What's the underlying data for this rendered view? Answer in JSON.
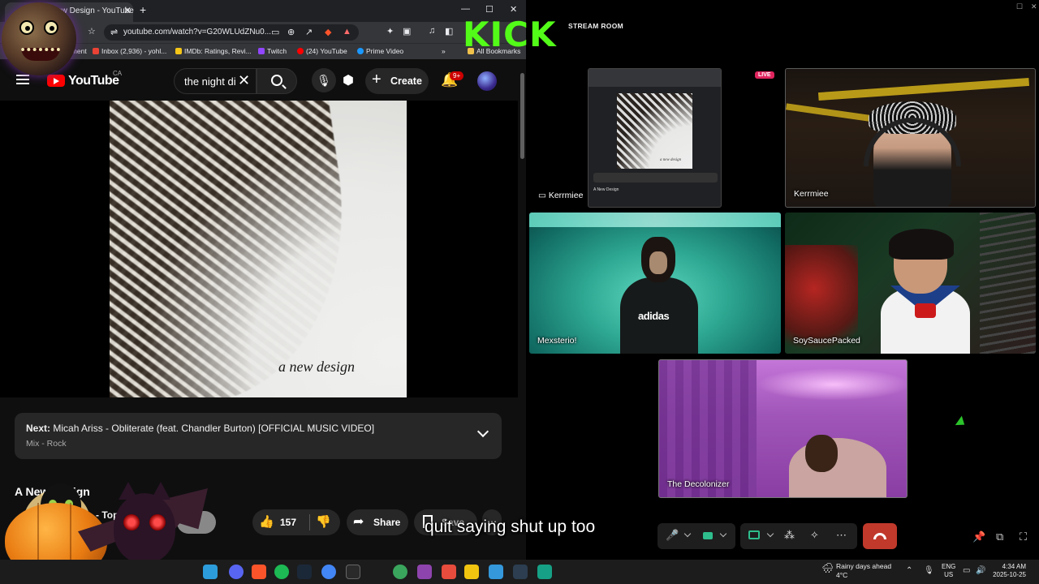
{
  "browser": {
    "tab_title": "A New Design - YouTube",
    "address": "youtube.com/watch?v=G20WLUdZNu0...",
    "bookmarks": [
      "...nment",
      "Inbox (2,936) - yohl...",
      "IMDb: Ratings, Revi...",
      "Twitch",
      "(24) YouTube",
      "Prime Video",
      "All Bookmarks"
    ],
    "bookmark_colors": [
      "#777777",
      "#ea4335",
      "#f5c518",
      "#9146ff",
      "#ff0000",
      "#1a98ff",
      "#f0c14b"
    ]
  },
  "youtube": {
    "logo_text": "YouTube",
    "region": "CA",
    "search_value": "the night di",
    "create_label": "Create",
    "notif_count": "9+",
    "album_caption": "a new design",
    "next_label": "Next:",
    "next_title": "Micah Ariss - Obliterate (feat. Chandler Burton) [OFFICIAL MUSIC VIDEO]",
    "next_sub": "Mix - Rock",
    "video_title": "A New Design",
    "channel": "- Top",
    "likes": "157",
    "share_label": "Share",
    "save_label": "Save"
  },
  "overlay": {
    "kick_text": "KICK",
    "subtitle": "quit saying shut up too"
  },
  "stream": {
    "room_title": "STREAM ROOM",
    "live_badge": "LIVE",
    "screen_share_name": "Kerrmiee",
    "participants": [
      "Kerrmiee",
      "Mexsterio!",
      "SoySaucePacked",
      "The Decolonizer"
    ],
    "mini_title": "A New Design"
  },
  "taskbar": {
    "weather_line1": "Rainy days ahead",
    "weather_line2": "4°C",
    "lang_line1": "ENG",
    "lang_line2": "US",
    "time": "4:34 AM",
    "date": "2025-10-25"
  },
  "colors": {
    "kick_green": "#53fc18",
    "youtube_red": "#ff0000",
    "hangup_red": "#c0392b",
    "live_pink": "#e0245e"
  }
}
